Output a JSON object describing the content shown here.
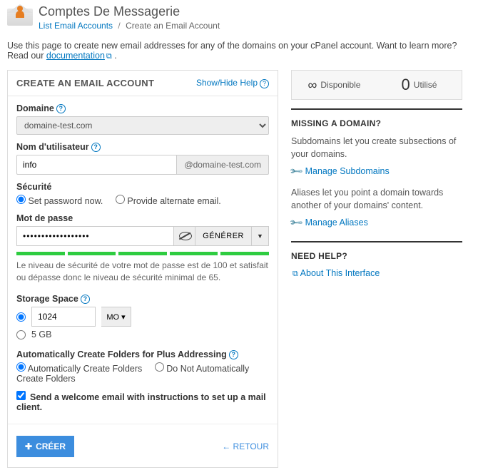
{
  "header": {
    "title": "Comptes De Messagerie",
    "breadcrumb": {
      "list": "List Email Accounts",
      "current": "Create an Email Account"
    }
  },
  "intro": {
    "text": "Use this page to create new email addresses for any of the domains on your cPanel account. Want to learn more? Read our ",
    "link": "documentation"
  },
  "panel": {
    "title": "CREATE AN EMAIL ACCOUNT",
    "showhide": "Show/Hide Help"
  },
  "domain": {
    "label": "Domaine",
    "value": "domaine-test.com"
  },
  "username": {
    "label": "Nom d'utilisateur",
    "value": "info",
    "suffix": "@domaine-test.com"
  },
  "security": {
    "label": "Sécurité",
    "optPassword": "Set password now.",
    "optAlt": "Provide alternate email."
  },
  "password": {
    "label": "Mot de passe",
    "value": "••••••••••••••••••",
    "generate": "GÉNÉRER",
    "hint": "Le niveau de sécurité de votre mot de passe est de 100 et satisfait ou dépasse donc le niveau de sécurité minimal de 65."
  },
  "storage": {
    "label": "Storage Space",
    "customValue": "1024",
    "unit": "MO",
    "fixed": "5 GB"
  },
  "plus": {
    "label": "Automatically Create Folders for Plus Addressing",
    "optAuto": "Automatically Create Folders",
    "optDont": "Do Not Automatically Create Folders"
  },
  "welcome": "Send a welcome email with instructions to set up a mail client.",
  "buttons": {
    "create": "CRÉER",
    "back": "RETOUR"
  },
  "stats": {
    "available": "Disponible",
    "used": "Utilisé",
    "usedCount": "0"
  },
  "sidebar": {
    "missingTitle": "MISSING A DOMAIN?",
    "sub": "Subdomains let you create subsections of your domains.",
    "subLink": "Manage Subdomains",
    "alias": "Aliases let you point a domain towards another of your domains' content.",
    "aliasLink": "Manage Aliases",
    "helpTitle": "NEED HELP?",
    "helpLink": "About This Interface"
  }
}
